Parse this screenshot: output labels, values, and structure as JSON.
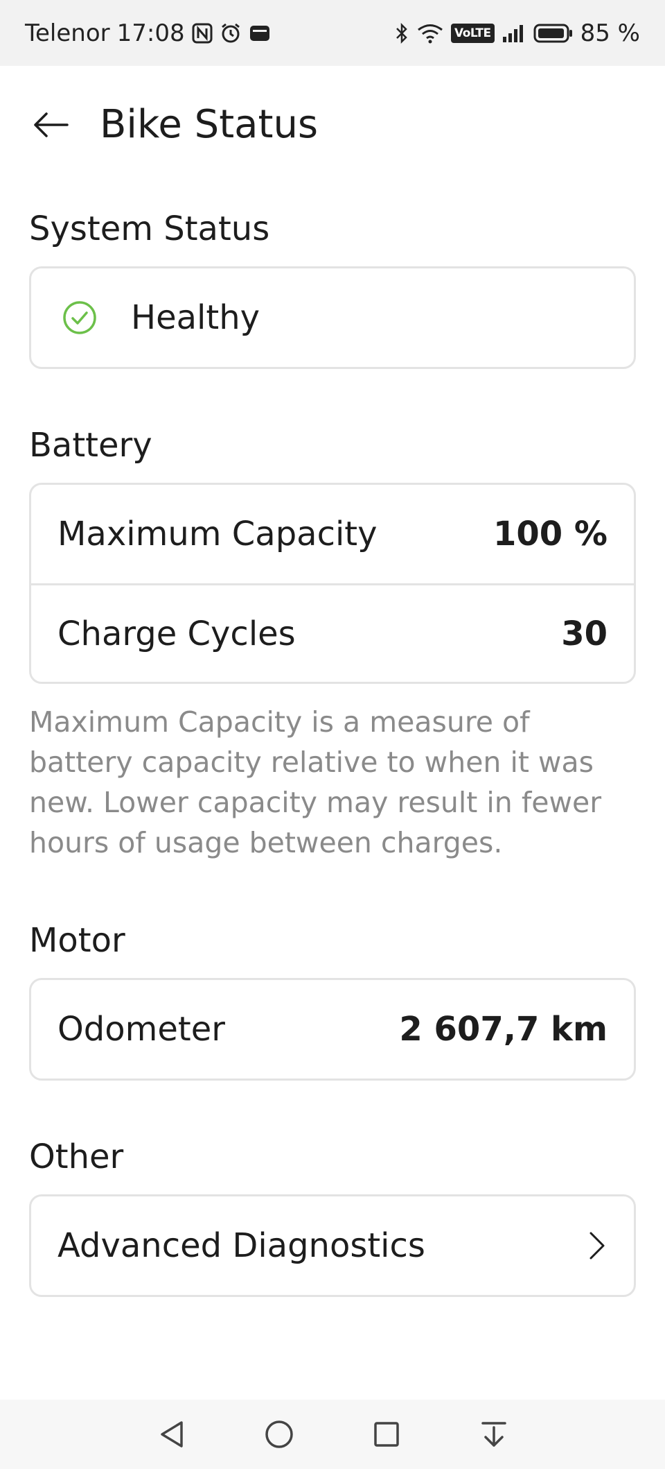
{
  "status_bar": {
    "carrier": "Telenor",
    "time": "17:08",
    "volte": "VoLTE",
    "battery_percent": "85 %"
  },
  "header": {
    "title": "Bike Status"
  },
  "system_status": {
    "title": "System Status",
    "status": "Healthy",
    "status_color": "#6cc04a"
  },
  "battery": {
    "title": "Battery",
    "rows": [
      {
        "label": "Maximum Capacity",
        "value": "100 %"
      },
      {
        "label": "Charge Cycles",
        "value": "30"
      }
    ],
    "note": "Maximum Capacity is a measure of battery capacity relative to when it was new. Lower capacity may result in fewer hours of usage between charges."
  },
  "motor": {
    "title": "Motor",
    "rows": [
      {
        "label": "Odometer",
        "value": "2 607,7 km"
      }
    ]
  },
  "other": {
    "title": "Other",
    "rows": [
      {
        "label": "Advanced Diagnostics"
      }
    ]
  }
}
